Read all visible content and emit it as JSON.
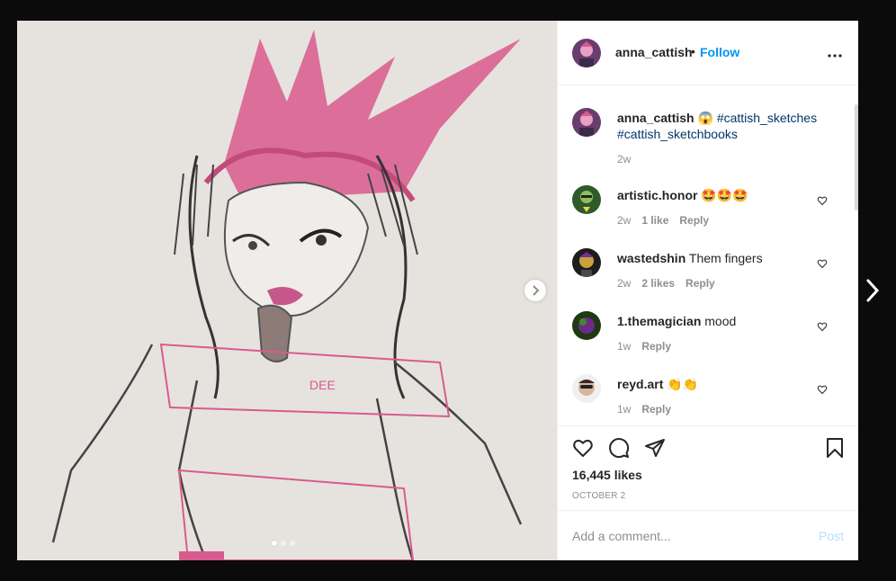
{
  "header": {
    "username": "anna_cattish",
    "separator": "•",
    "follow_label": "Follow",
    "more_icon": "more-horizontal-icon"
  },
  "caption": {
    "username": "anna_cattish",
    "emoji": "😱",
    "tag1": "#cattish_sketches",
    "tag2": "#cattish_sketchbooks",
    "time": "2w"
  },
  "comments": [
    {
      "username": "artistic.honor",
      "text": "🤩🤩🤩",
      "time": "2w",
      "likes": "1 like",
      "reply": "Reply"
    },
    {
      "username": "wastedshin",
      "text": "Them fingers",
      "time": "2w",
      "likes": "2 likes",
      "reply": "Reply"
    },
    {
      "username": "1.themagician",
      "text": "mood",
      "time": "1w",
      "likes": "",
      "reply": "Reply"
    },
    {
      "username": "reyd.art",
      "text": "👏👏",
      "time": "1w",
      "likes": "",
      "reply": "Reply"
    }
  ],
  "post": {
    "likes": "16,445 likes",
    "date": "OCTOBER 2"
  },
  "comment_box": {
    "placeholder": "Add a comment...",
    "post_label": "Post"
  },
  "carousel": {
    "slide_count": 3,
    "active_index": 0
  },
  "colors": {
    "follow": "#0095f6",
    "hashtag": "#00376b",
    "post_disabled": "#b2dffc"
  }
}
